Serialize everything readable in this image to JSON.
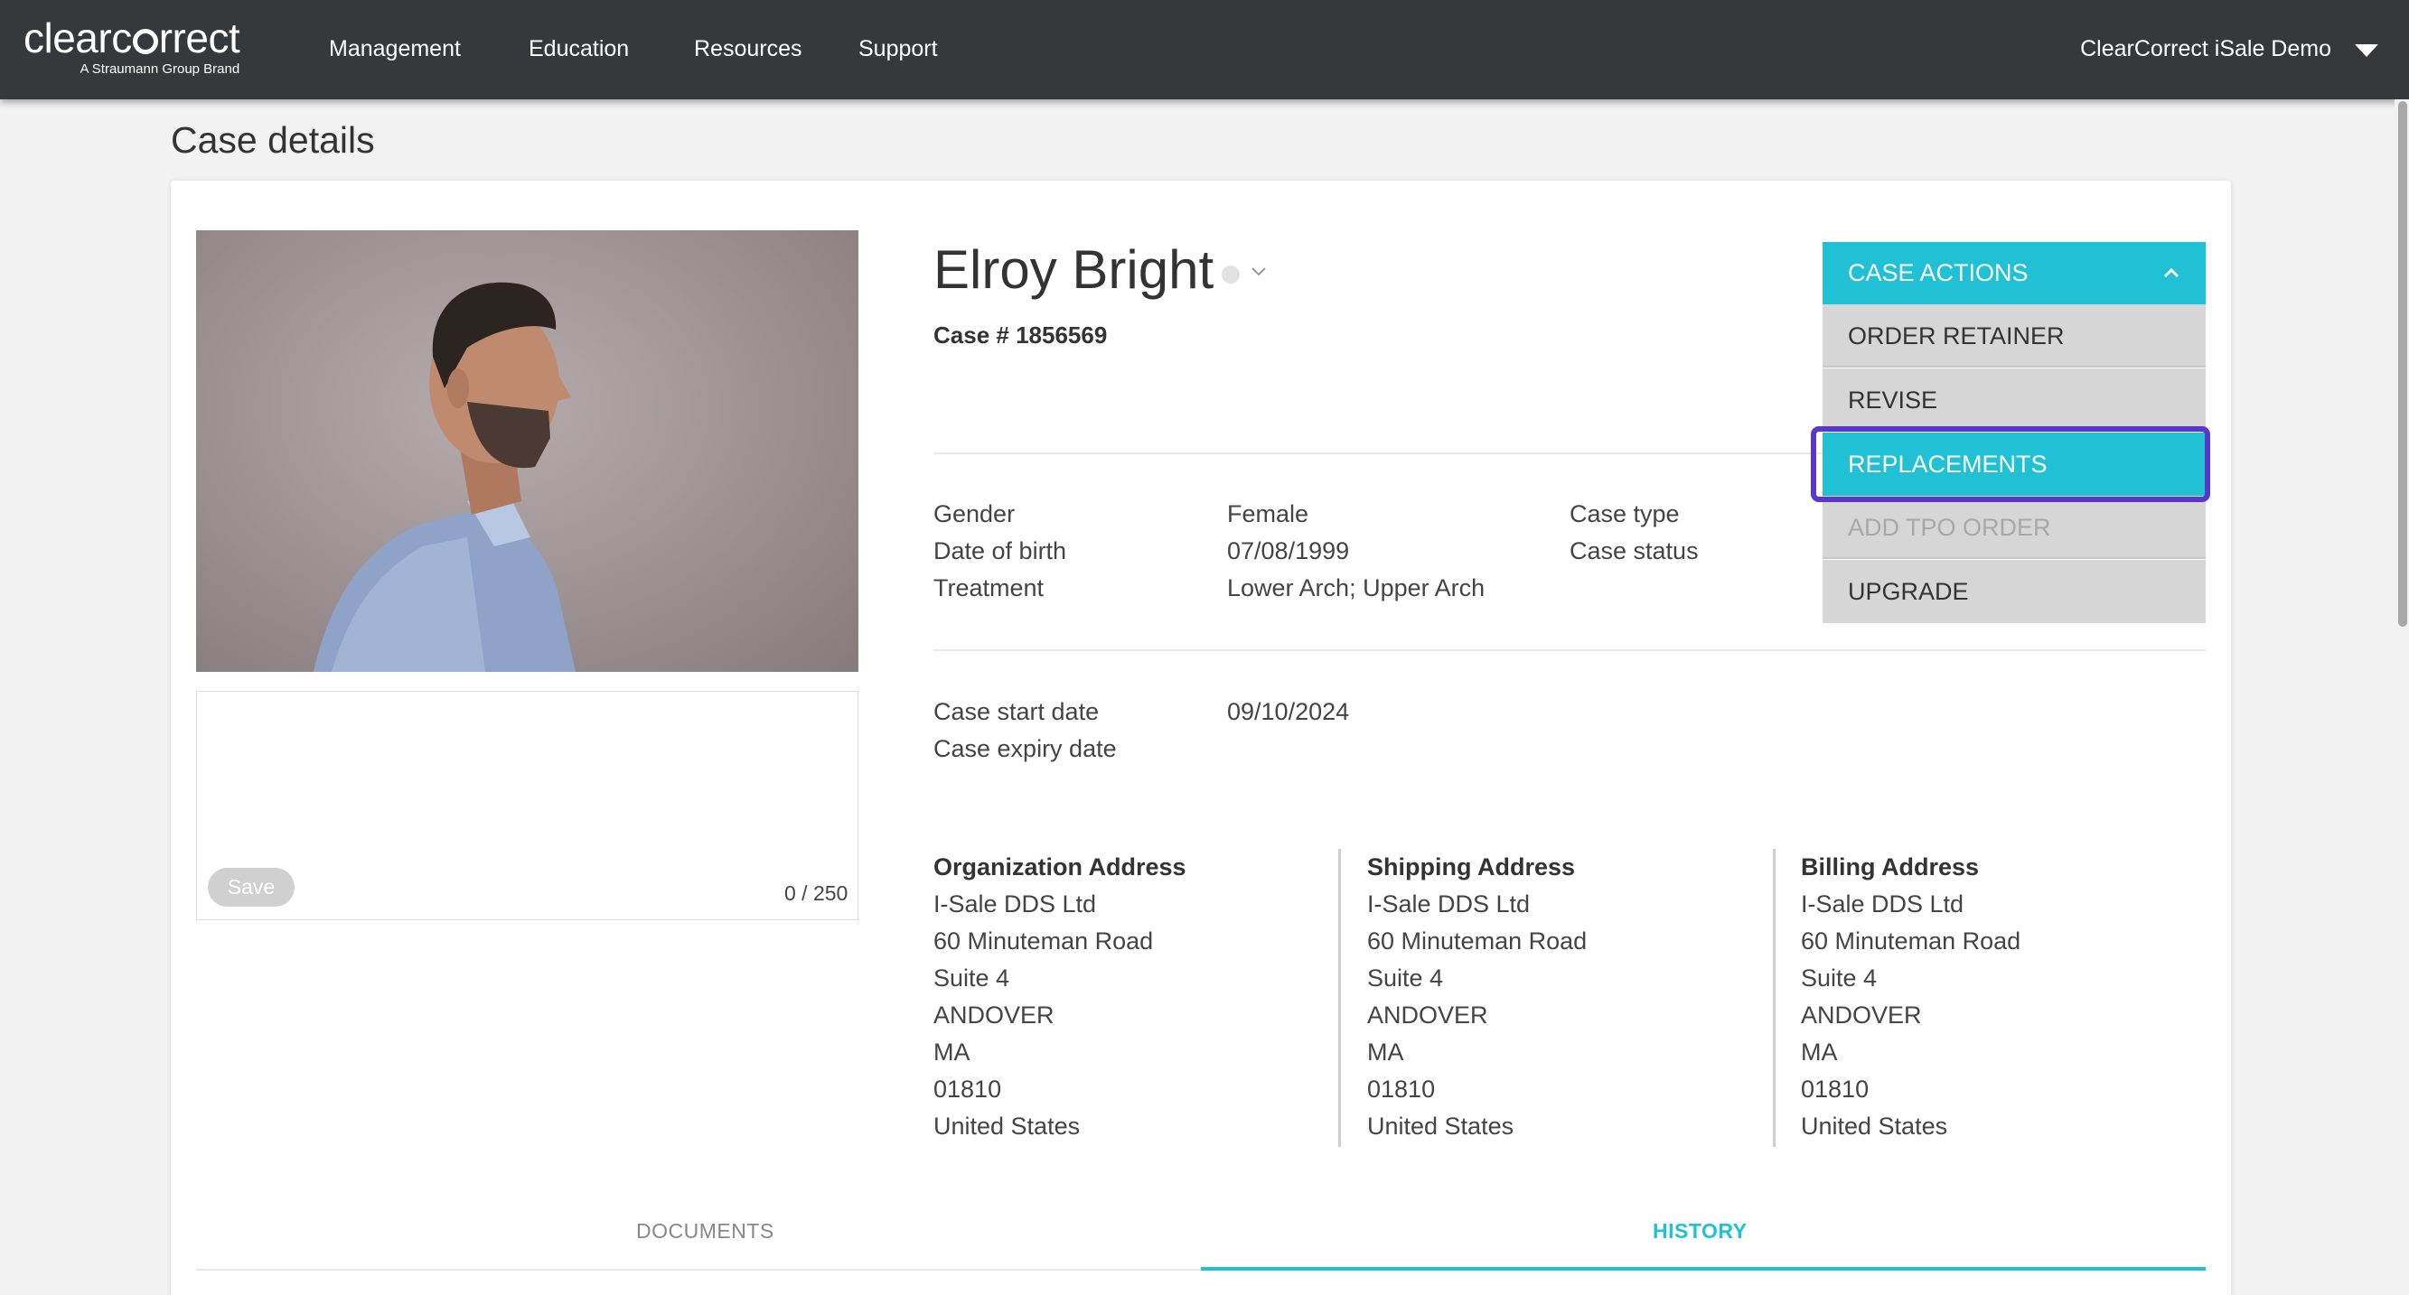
{
  "brand": {
    "wordmark_left": "clearc",
    "wordmark_right": "rrect",
    "tagline": "A Straumann Group Brand"
  },
  "nav": {
    "items": [
      "Management",
      "Education",
      "Resources",
      "Support"
    ],
    "user_label": "ClearCorrect iSale Demo"
  },
  "page": {
    "title": "Case details"
  },
  "patient": {
    "name": "Elroy Bright",
    "case_number": "Case # 1856569"
  },
  "details": {
    "labels": [
      "Gender",
      "Date of birth",
      "Treatment"
    ],
    "values": [
      "Female",
      "07/08/1999",
      "Lower Arch; Upper Arch"
    ],
    "labels_right": [
      "Case type",
      "Case status"
    ],
    "dates_labels": [
      "Case start date",
      "Case expiry date"
    ],
    "dates_values": [
      "09/10/2024"
    ]
  },
  "notes": {
    "save_label": "Save",
    "char_count": "0 / 250"
  },
  "addresses": [
    {
      "title": "Organization Address",
      "lines": [
        "I-Sale DDS Ltd",
        "60 Minuteman Road",
        "Suite 4",
        "ANDOVER",
        "MA",
        "01810",
        "United States"
      ]
    },
    {
      "title": "Shipping Address",
      "lines": [
        "I-Sale DDS Ltd",
        "60 Minuteman Road",
        "Suite 4",
        "ANDOVER",
        "MA",
        "01810",
        "United States"
      ]
    },
    {
      "title": "Billing Address",
      "lines": [
        "I-Sale DDS Ltd",
        "60 Minuteman Road",
        "Suite 4",
        "ANDOVER",
        "MA",
        "01810",
        "United States"
      ]
    }
  ],
  "case_actions": {
    "label": "CASE ACTIONS",
    "items": [
      "ORDER RETAINER",
      "REVISE",
      "REPLACEMENTS",
      "ADD TPO ORDER",
      "UPGRADE"
    ],
    "highlighted": "REPLACEMENTS",
    "disabled": "ADD TPO ORDER"
  },
  "tabs": {
    "items": [
      "DOCUMENTS",
      "HISTORY"
    ],
    "active": "HISTORY"
  },
  "colors": {
    "accent": "#20c1d4",
    "nav_bg": "#35393b",
    "focus_ring": "#5b37c9",
    "menu_bg": "#d6d6d6"
  }
}
